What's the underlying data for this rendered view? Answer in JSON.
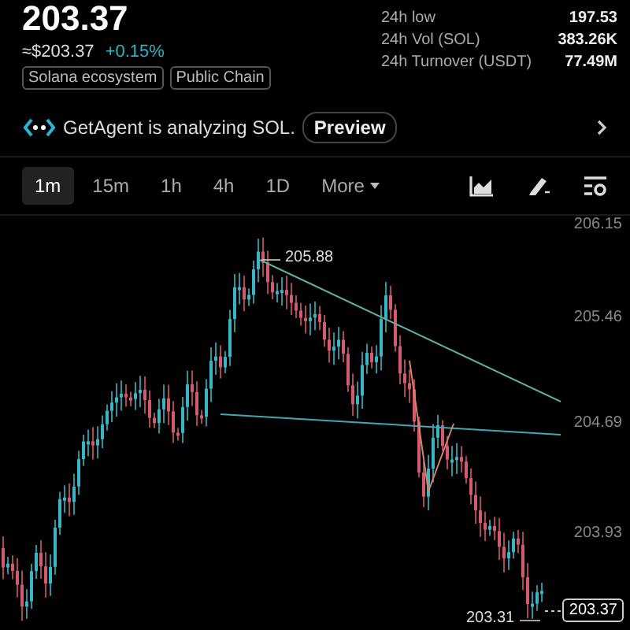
{
  "header": {
    "price": "203.37",
    "fiat_price": "≈$203.37",
    "change": "+0.15%",
    "tags": [
      "Solana ecosystem",
      "Public Chain"
    ]
  },
  "stats": [
    {
      "label": "24h low",
      "value": "197.53"
    },
    {
      "label": "24h Vol (SOL)",
      "value": "383.26K"
    },
    {
      "label": "24h Turnover (USDT)",
      "value": "77.49M"
    }
  ],
  "agent_banner": {
    "text": "GetAgent is analyzing SOL.",
    "button": "Preview"
  },
  "intervals": [
    {
      "label": "1m",
      "selected": true
    },
    {
      "label": "15m",
      "selected": false
    },
    {
      "label": "1h",
      "selected": false
    },
    {
      "label": "4h",
      "selected": false
    },
    {
      "label": "1D",
      "selected": false
    }
  ],
  "more_menu": {
    "label": "More"
  },
  "chart": {
    "price_axis": [
      "206.15",
      "205.46",
      "204.69",
      "203.93"
    ],
    "high_label": "205.88",
    "low_label": "203.31",
    "last_price": "203.37"
  }
}
